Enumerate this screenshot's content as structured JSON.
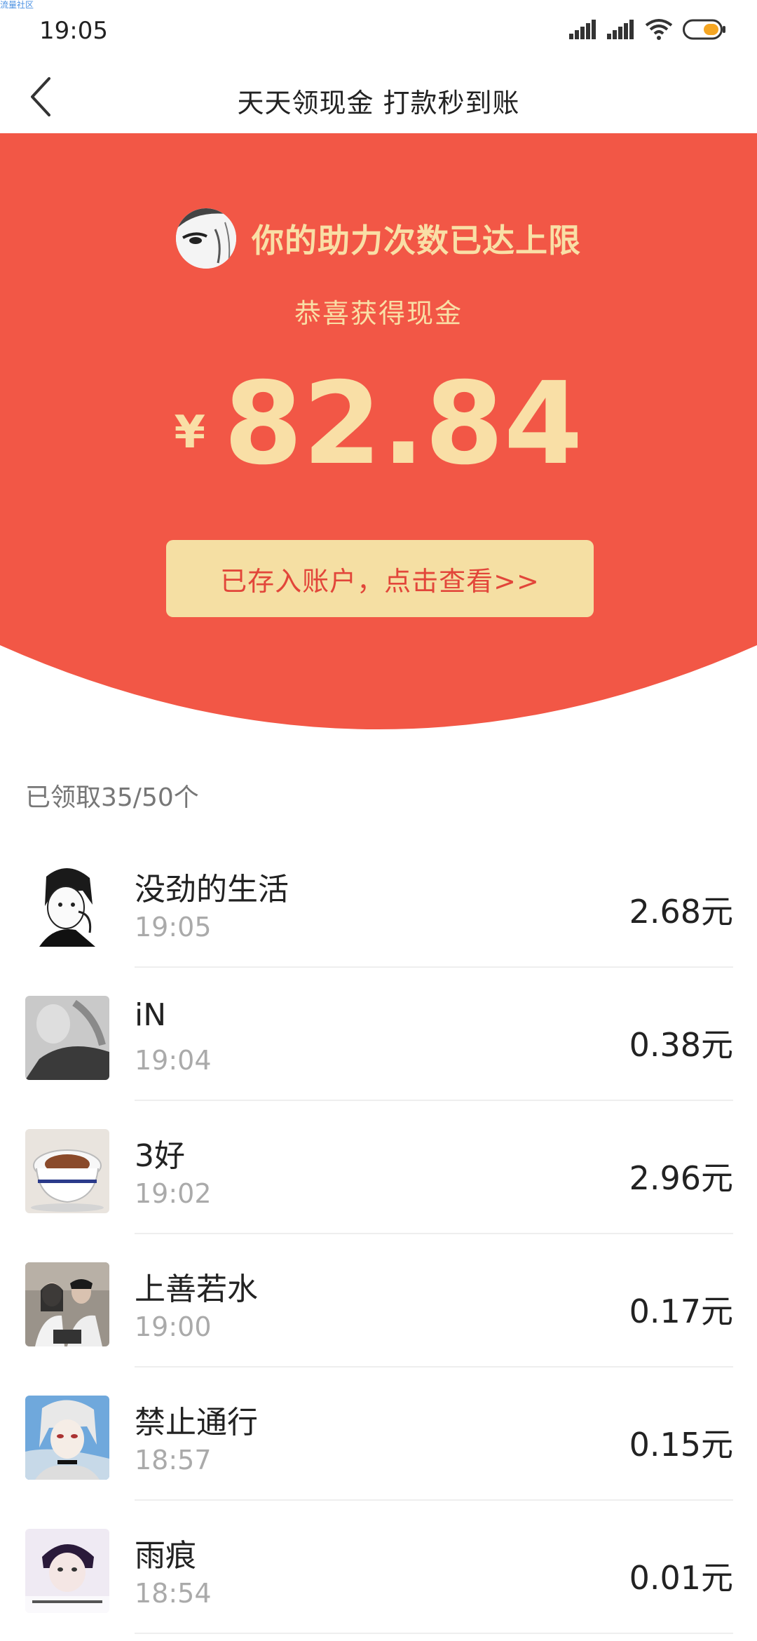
{
  "status_bar": {
    "watermark": "流量社区",
    "time": "19:05",
    "icons": [
      "signal-icon",
      "signal-icon",
      "wifi-icon",
      "battery-icon"
    ]
  },
  "nav": {
    "back_icon": "chevron-left-icon",
    "title": "天天领现金 打款秒到账"
  },
  "hero": {
    "limit_text": "你的助力次数已达上限",
    "congrats_text": "恭喜获得现金",
    "currency": "¥",
    "amount": "82.84",
    "button_label": "已存入账户，点击查看>>",
    "colors": {
      "background": "#f25746",
      "accent_text": "#f9dfa6",
      "button_bg": "#f5dfa3",
      "button_text": "#e2463a"
    }
  },
  "claimed": {
    "label": "已领取35/50个"
  },
  "list": [
    {
      "name": "没劲的生活",
      "time": "19:05",
      "amount": "2.68元"
    },
    {
      "name": "iN",
      "time": "19:04",
      "amount": "0.38元"
    },
    {
      "name": "3好",
      "time": "19:02",
      "amount": "2.96元"
    },
    {
      "name": "上善若水",
      "time": "19:00",
      "amount": "0.17元"
    },
    {
      "name": "禁止通行",
      "time": "18:57",
      "amount": "0.15元"
    },
    {
      "name": "雨痕",
      "time": "18:54",
      "amount": "0.01元"
    }
  ]
}
